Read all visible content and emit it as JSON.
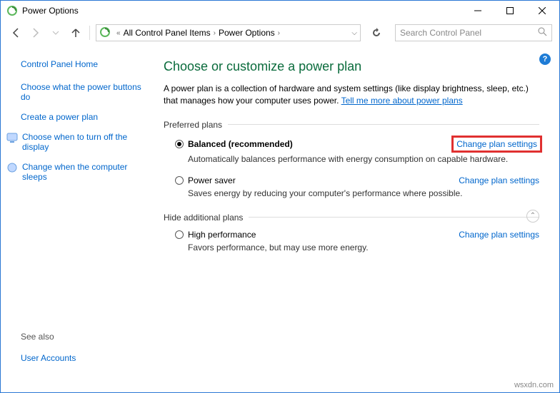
{
  "title": "Power Options",
  "breadcrumb": {
    "prefix": "«",
    "item1": "All Control Panel Items",
    "item2": "Power Options"
  },
  "search": {
    "placeholder": "Search Control Panel"
  },
  "sidebar": {
    "home": "Control Panel Home",
    "items": [
      "Choose what the power buttons do",
      "Create a power plan",
      "Choose when to turn off the display",
      "Change when the computer sleeps"
    ],
    "seealso": "See also",
    "useracct": "User Accounts"
  },
  "main": {
    "heading": "Choose or customize a power plan",
    "desc1": "A power plan is a collection of hardware and system settings (like display brightness, sleep, etc.) that manages how your computer uses power. ",
    "desclink": "Tell me more about power plans",
    "preferred": "Preferred plans",
    "hide": "Hide additional plans",
    "plans": [
      {
        "name": "Balanced (recommended)",
        "desc": "Automatically balances performance with energy consumption on capable hardware.",
        "selected": true,
        "highlight": true
      },
      {
        "name": "Power saver",
        "desc": "Saves energy by reducing your computer's performance where possible.",
        "selected": false,
        "highlight": false
      },
      {
        "name": "High performance",
        "desc": "Favors performance, but may use more energy.",
        "selected": false,
        "highlight": false
      }
    ],
    "cps": "Change plan settings"
  },
  "watermark": "wsxdn.com"
}
